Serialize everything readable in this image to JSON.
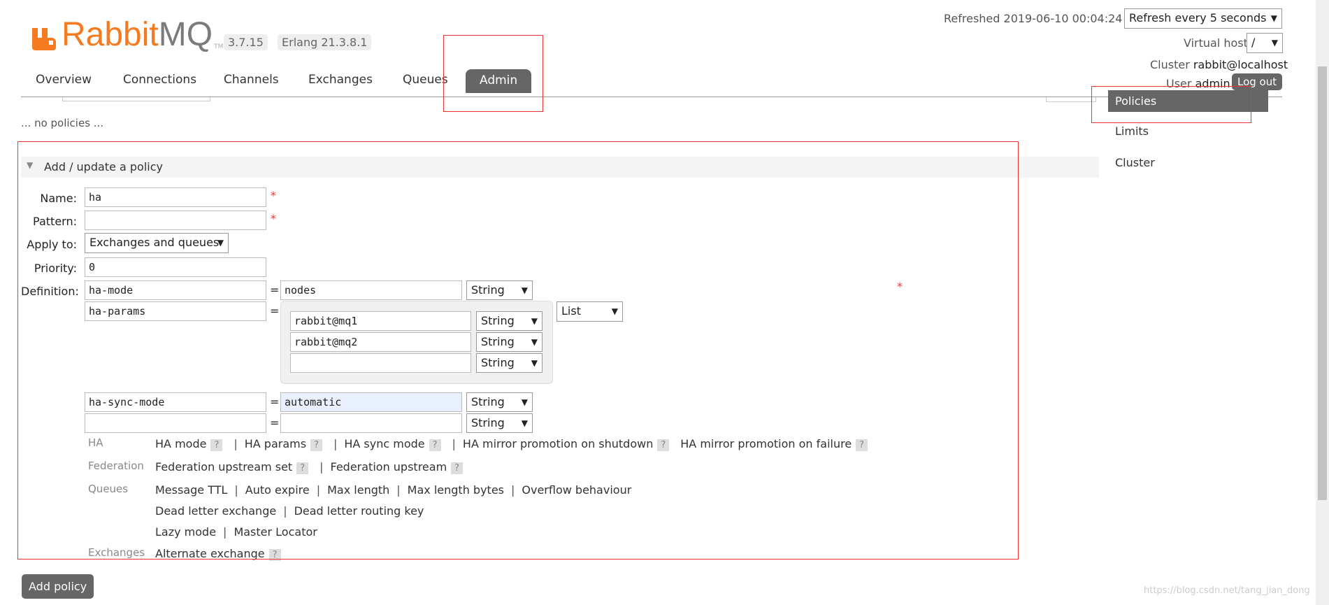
{
  "header": {
    "logo_text_a": "Rabbit",
    "logo_text_b": "MQ",
    "logo_tm": "TM",
    "version": "3.7.15",
    "erlang": "Erlang 21.3.8.1",
    "refreshed": "Refreshed 2019-06-10 00:04:24",
    "refresh_select": "Refresh every 5 seconds",
    "vhost_label": "Virtual host",
    "vhost_value": "/",
    "cluster_label": "Cluster",
    "cluster_value": "rabbit@localhost",
    "user_label": "User",
    "user_value": "admin",
    "logout": "Log out"
  },
  "tabs": [
    "Overview",
    "Connections",
    "Channels",
    "Exchanges",
    "Queues",
    "Admin"
  ],
  "sidebar": [
    "Policies",
    "Limits",
    "Cluster"
  ],
  "no_policies": "... no policies ...",
  "section_title": "Add / update a policy",
  "form": {
    "name_label": "Name:",
    "name_value": "ha",
    "pattern_label": "Pattern:",
    "pattern_value": "",
    "apply_label": "Apply to:",
    "apply_value": "Exchanges and queues",
    "priority_label": "Priority:",
    "priority_value": "0",
    "definition_label": "Definition:",
    "star": "*",
    "eq": "=",
    "rows": [
      {
        "key": "ha-mode",
        "value": "nodes",
        "type": "String"
      },
      {
        "key": "ha-params",
        "list_type": "List",
        "items": [
          {
            "value": "rabbit@mq1",
            "type": "String"
          },
          {
            "value": "rabbit@mq2",
            "type": "String"
          },
          {
            "value": "",
            "type": "String"
          }
        ]
      },
      {
        "key": "ha-sync-mode",
        "value": "automatic",
        "type": "String"
      },
      {
        "key": "",
        "value": "",
        "type": "String"
      }
    ]
  },
  "help": {
    "ha_label": "HA",
    "ha": [
      "HA mode",
      "HA params",
      "HA sync mode",
      "HA mirror promotion on shutdown",
      "HA mirror promotion on failure"
    ],
    "federation_label": "Federation",
    "federation": [
      "Federation upstream set",
      "Federation upstream"
    ],
    "queues_label": "Queues",
    "queues_row1": [
      "Message TTL",
      "Auto expire",
      "Max length",
      "Max length bytes",
      "Overflow behaviour"
    ],
    "queues_row2": [
      "Dead letter exchange",
      "Dead letter routing key"
    ],
    "queues_row3": [
      "Lazy mode",
      "Master Locator"
    ],
    "exchanges_label": "Exchanges",
    "exchanges": [
      "Alternate exchange"
    ],
    "q": "?",
    "sep": "|"
  },
  "add_button": "Add policy",
  "watermark": "https://blog.csdn.net/tang_jian_dong",
  "colors": {
    "brand_orange": "#f47b20",
    "tab_active": "#666666",
    "annotation_red": "#e33333"
  }
}
